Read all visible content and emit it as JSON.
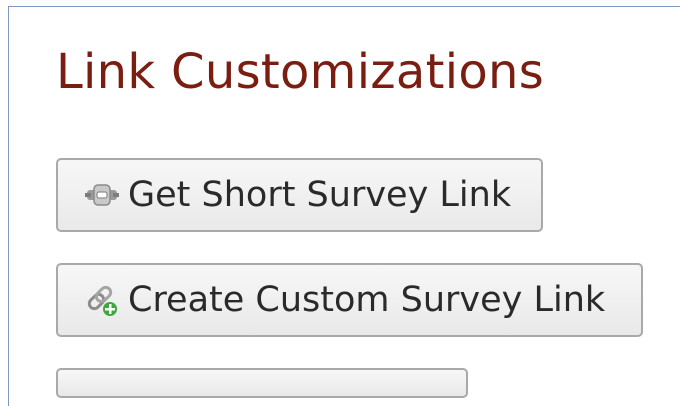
{
  "section": {
    "title": "Link Customizations"
  },
  "buttons": [
    {
      "label": "Get Short Survey Link",
      "icon": "short-link-icon"
    },
    {
      "label": "Create Custom Survey Link",
      "icon": "custom-link-add-icon"
    }
  ]
}
